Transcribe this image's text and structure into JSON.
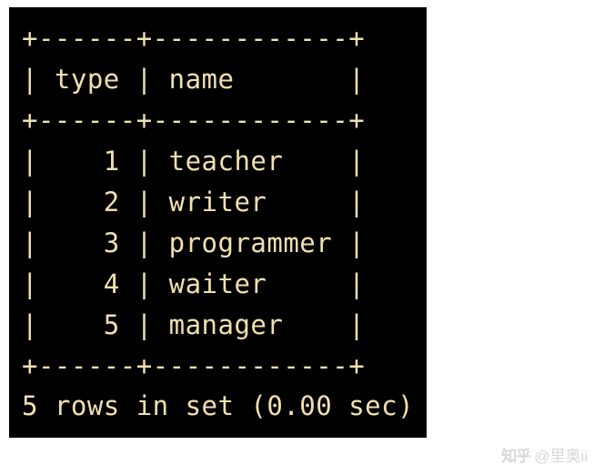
{
  "table": {
    "border_top": "+------+------------+",
    "header_line": "| type | name       |",
    "border_mid": "+------+------------+",
    "rows": [
      "|    1 | teacher    |",
      "|    2 | writer     |",
      "|    3 | programmer |",
      "|    4 | waiter     |",
      "|    5 | manager    |"
    ],
    "border_bottom": "+------+------------+",
    "status": "5 rows in set (0.00 sec)"
  },
  "chart_data": {
    "type": "table",
    "columns": [
      "type",
      "name"
    ],
    "rows": [
      {
        "type": 1,
        "name": "teacher"
      },
      {
        "type": 2,
        "name": "writer"
      },
      {
        "type": 3,
        "name": "programmer"
      },
      {
        "type": 4,
        "name": "waiter"
      },
      {
        "type": 5,
        "name": "manager"
      }
    ],
    "row_count": 5,
    "duration_sec": 0.0
  },
  "watermark": {
    "logo_text": "知乎",
    "author": "@里奥ii"
  }
}
